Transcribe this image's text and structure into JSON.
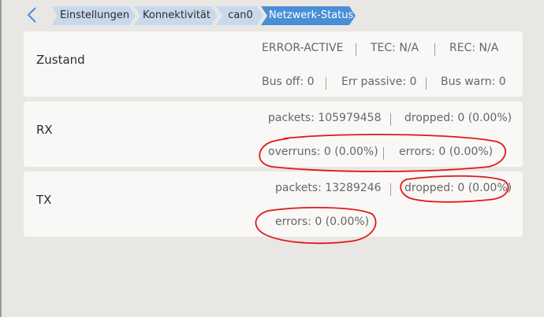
{
  "breadcrumb": {
    "items": [
      "Einstellungen",
      "Konnektivität",
      "can0",
      "Netzwerk-Status"
    ]
  },
  "state": {
    "title": "Zustand",
    "status": "ERROR-ACTIVE",
    "tec": "TEC: N/A",
    "rec": "REC: N/A",
    "bus_off": "Bus off: 0",
    "err_passive": "Err passive: 0",
    "bus_warn": "Bus warn: 0"
  },
  "rx": {
    "title": "RX",
    "packets": "packets: 105979458",
    "dropped": "dropped: 0 (0.00%)",
    "overruns": "overruns: 0 (0.00%)",
    "errors": "errors: 0 (0.00%)"
  },
  "tx": {
    "title": "TX",
    "packets": "packets: 13289246",
    "dropped": "dropped: 0 (0.00%)",
    "errors": "errors: 0 (0.00%)"
  },
  "colors": {
    "accent": "#4a8fd6",
    "crumb_inactive": "#c9d9ec",
    "annotation": "#e01818"
  }
}
